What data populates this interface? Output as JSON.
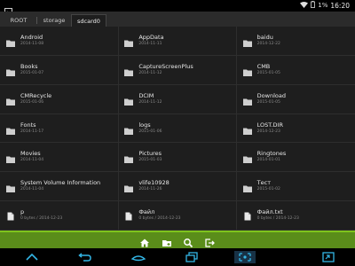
{
  "status_bar": {
    "time": "16:20",
    "battery": "1%"
  },
  "tabs": [
    {
      "label": "ROOT"
    },
    {
      "label": "storage"
    },
    {
      "label": "sdcard0"
    }
  ],
  "items": [
    {
      "name": "Android",
      "detail": "2014-11-08",
      "type": "folder"
    },
    {
      "name": "AppData",
      "detail": "2014-11-11",
      "type": "folder"
    },
    {
      "name": "baidu",
      "detail": "2014-12-22",
      "type": "folder"
    },
    {
      "name": "Books",
      "detail": "2015-01-07",
      "type": "folder"
    },
    {
      "name": "CaptureScreenPlus",
      "detail": "2014-11-12",
      "type": "folder"
    },
    {
      "name": "CMB",
      "detail": "2015-01-05",
      "type": "folder"
    },
    {
      "name": "CMRecycle",
      "detail": "2015-01-06",
      "type": "folder"
    },
    {
      "name": "DCIM",
      "detail": "2014-11-12",
      "type": "folder"
    },
    {
      "name": "Download",
      "detail": "2015-01-05",
      "type": "folder"
    },
    {
      "name": "Fonts",
      "detail": "2014-11-17",
      "type": "folder"
    },
    {
      "name": "logs",
      "detail": "2015-01-06",
      "type": "folder"
    },
    {
      "name": "LOST.DIR",
      "detail": "2014-12-23",
      "type": "folder"
    },
    {
      "name": "Movies",
      "detail": "2014-11-04",
      "type": "folder"
    },
    {
      "name": "Pictures",
      "detail": "2015-01-03",
      "type": "folder"
    },
    {
      "name": "Ringtones",
      "detail": "2014-01-01",
      "type": "folder"
    },
    {
      "name": "System Volume Information",
      "detail": "2014-11-04",
      "type": "folder"
    },
    {
      "name": "vlife10928",
      "detail": "2014-11-26",
      "type": "folder"
    },
    {
      "name": "Тест",
      "detail": "2015-01-02",
      "type": "folder"
    },
    {
      "name": "p",
      "detail": "0 bytes / 2014-12-23",
      "type": "file"
    },
    {
      "name": "Файл",
      "detail": "0 bytes / 2014-12-23",
      "type": "file"
    },
    {
      "name": "Файл.txt",
      "detail": "0 bytes / 2014-12-23",
      "type": "file"
    }
  ],
  "action_bar": [
    "home-icon",
    "folder-add-icon",
    "search-icon",
    "exit-icon"
  ],
  "nav_bar": [
    "collapse-icon",
    "back-icon",
    "home-icon",
    "recents-icon",
    "screenshot-icon",
    "expand-icon"
  ],
  "colors": {
    "accent_green": "#7fc31c",
    "action_bar": "#5a8d1a",
    "background": "#1e1e1e",
    "nav_blue": "#33b5e5"
  }
}
